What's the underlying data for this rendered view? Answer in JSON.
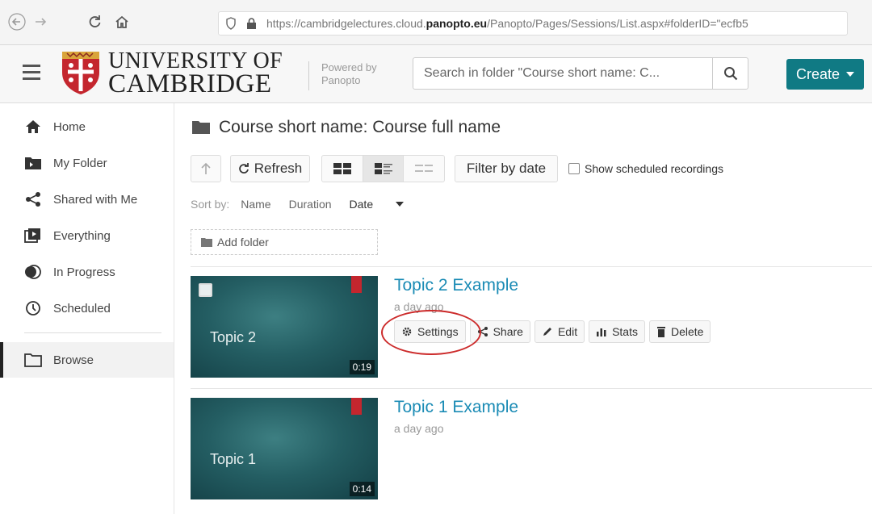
{
  "browser": {
    "url_prefix": "https://cambridgelectures.cloud.",
    "url_domain": "panopto.eu",
    "url_path": "/Panopto/Pages/Sessions/List.aspx#folderID=\"ecfb5"
  },
  "header": {
    "logo_line1": "UNIVERSITY OF",
    "logo_line2": "CAMBRIDGE",
    "powered_line1": "Powered by",
    "powered_line2": "Panopto",
    "search_placeholder": "Search in folder \"Course short name: C...",
    "create_label": "Create",
    "brand_color": "#107a84"
  },
  "sidebar": {
    "items": [
      {
        "label": "Home",
        "icon": "home-icon"
      },
      {
        "label": "My Folder",
        "icon": "folder-icon"
      },
      {
        "label": "Shared with Me",
        "icon": "share-icon"
      },
      {
        "label": "Everything",
        "icon": "playlist-icon"
      },
      {
        "label": "In Progress",
        "icon": "in-progress-icon"
      },
      {
        "label": "Scheduled",
        "icon": "clock-icon"
      },
      {
        "label": "Browse",
        "icon": "folder-outline-icon"
      }
    ]
  },
  "main": {
    "folder_title": "Course short name: Course full name",
    "refresh_label": "Refresh",
    "filter_label": "Filter by date",
    "show_scheduled_label": "Show scheduled recordings",
    "sort": {
      "label": "Sort by:",
      "options": [
        "Name",
        "Duration",
        "Date"
      ],
      "active": "Date"
    },
    "add_folder_label": "Add folder",
    "sessions": [
      {
        "title": "Topic 2 Example",
        "date": "a day ago",
        "thumb_title": "Topic 2",
        "duration": "0:19",
        "actions": [
          "Settings",
          "Share",
          "Edit",
          "Stats",
          "Delete"
        ]
      },
      {
        "title": "Topic 1 Example",
        "date": "a day ago",
        "thumb_title": "Topic 1",
        "duration": "0:14"
      }
    ]
  }
}
